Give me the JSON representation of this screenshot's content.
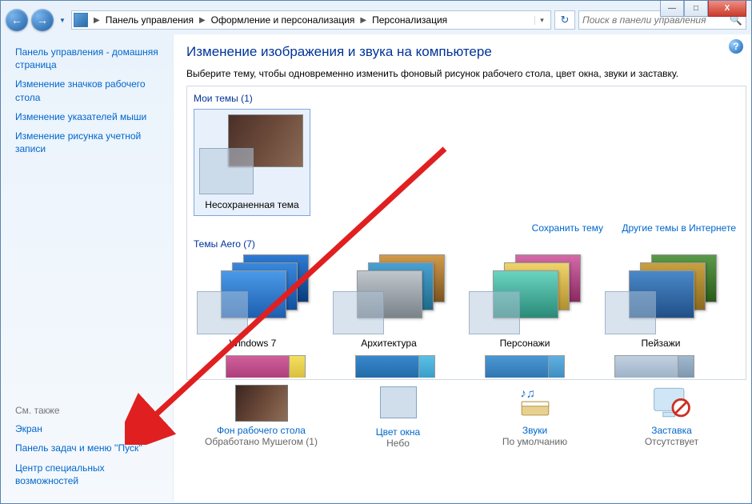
{
  "window": {
    "min": "—",
    "max": "□",
    "close": "X"
  },
  "breadcrumb": {
    "items": [
      "Панель управления",
      "Оформление и персонализация",
      "Персонализация"
    ]
  },
  "search": {
    "placeholder": "Поиск в панели управления"
  },
  "sidebar": {
    "links": [
      "Панель управления - домашняя страница",
      "Изменение значков рабочего стола",
      "Изменение указателей мыши",
      "Изменение рисунка учетной записи"
    ],
    "see_also_header": "См. также",
    "see_also": [
      "Экран",
      "Панель задач и меню ''Пуск''",
      "Центр специальных возможностей"
    ]
  },
  "main": {
    "title": "Изменение изображения и звука на компьютере",
    "subtitle": "Выберите тему, чтобы одновременно изменить фоновый рисунок рабочего стола, цвет окна, звуки и заставку.",
    "my_themes_label": "Мои темы (1)",
    "unsaved_theme": "Несохраненная тема",
    "save_theme": "Сохранить тему",
    "more_themes": "Другие темы в Интернете",
    "aero_label": "Темы Aero (7)",
    "aero_items": [
      "Windows 7",
      "Архитектура",
      "Персонажи",
      "Пейзажи"
    ]
  },
  "bottom": {
    "bg": {
      "label": "Фон рабочего стола",
      "sub": "Обработано Мушегом (1)"
    },
    "color": {
      "label": "Цвет окна",
      "sub": "Небо"
    },
    "sound": {
      "label": "Звуки",
      "sub": "По умолчанию"
    },
    "saver": {
      "label": "Заставка",
      "sub": "Отсутствует"
    }
  }
}
